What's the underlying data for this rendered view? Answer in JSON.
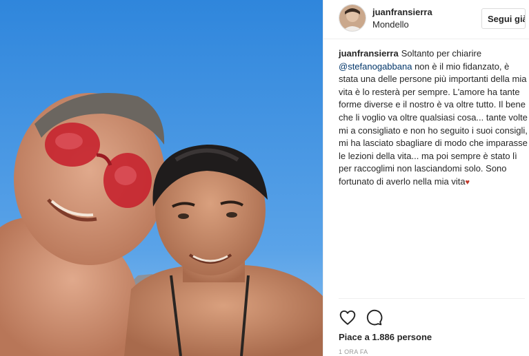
{
  "post": {
    "photo_icon": "selfie-photo",
    "header": {
      "username": "juanfransierra",
      "location": "Mondello",
      "follow_label": "Segui già"
    },
    "caption": {
      "username": "juanfransierra",
      "text_1": "Soltanto per chiarire",
      "mention": "@stefanogabbana",
      "text_2": " non è il mio fidanzato, è stata una delle persone più importanti della mia vita è lo resterà per sempre. L'amore ha tante forme diverse e il nostro è va oltre tutto. Il bene che li voglio va oltre qualsiasi cosa... tante volte mi a consigliato e non ho seguito i suoi consigli, mi ha lasciato sbagliare di modo che imparasse le lezioni della vita... ma poi sempre è stato lì per raccoglimi non lasciandomi solo. Sono fortunato di averlo nella mia vita",
      "emoji": "♥"
    },
    "actions": {
      "like_icon": "heart-icon",
      "comment_icon": "comment-icon"
    },
    "likes_text": "Piace a 1.886 persone",
    "timestamp": "1 ORA FA",
    "colors": {
      "sky": "#3a8ee0",
      "text": "#262626",
      "mention": "#003569",
      "muted": "#999999",
      "border": "#dbdbdb"
    }
  }
}
